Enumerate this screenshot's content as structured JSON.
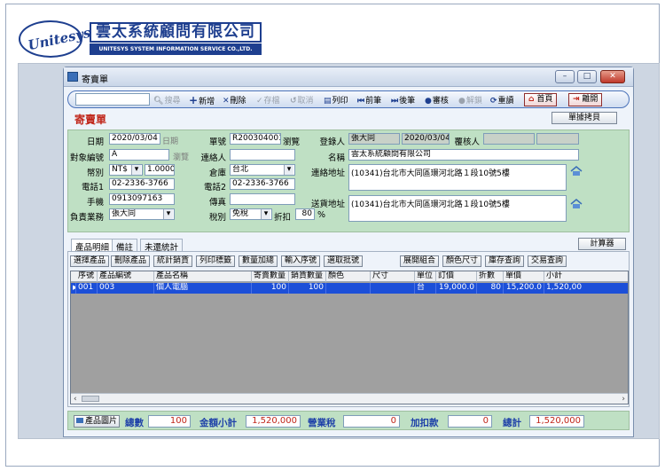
{
  "brand": {
    "logo_text": "Unitesys",
    "name_zh": "雲太系統顧問有限公司",
    "name_en": "UNITESYS SYSTEM INFORMATION SERVICE CO.,LTD."
  },
  "window": {
    "title": "寄賣單",
    "minimize": "–",
    "maximize": "□",
    "close": "✕"
  },
  "toolbar": {
    "search_value": "",
    "search": "搜尋",
    "add": "新增",
    "delete": "刪除",
    "save": "存檔",
    "cancel": "取消",
    "print": "列印",
    "prev": "前筆",
    "next": "後筆",
    "review": "審核",
    "unreview": "解鎖",
    "reload": "重讀",
    "home": "首頁",
    "exit": "離開"
  },
  "form": {
    "title": "寄賣單",
    "copy_button": "單據拷貝",
    "date_label": "日期",
    "date_value": "2020/03/04",
    "date_link": "日期",
    "order_no_label": "單號",
    "order_no_value": "R200304001",
    "browse": "瀏覽",
    "registrant_label": "登錄人",
    "registrant_value": "張大同",
    "registrant_date": "2020/03/04",
    "reviewer_label": "覆核人",
    "reviewer_value": "",
    "target_code_label": "對象編號",
    "target_code_value": "A",
    "browse2": "瀏覽",
    "contact_label": "連絡人",
    "contact_value": "",
    "name_label": "名稱",
    "name_value": "雲太系統顧問有限公司",
    "currency_label": "幣別",
    "currency_value": "NT$",
    "rate_value": "1.0000",
    "warehouse_label": "倉庫",
    "warehouse_value": "台北",
    "address_label": "連絡地址",
    "address_value": "(10341)台北市大同區環河北路１段10號5樓",
    "phone1_label": "電話1",
    "phone1_value": "02-2336-3766",
    "phone2_label": "電話2",
    "phone2_value": "02-2336-3766",
    "mobile_label": "手機",
    "mobile_value": "0913097163",
    "fax_label": "傳真",
    "fax_value": "",
    "ship_address_label": "送貨地址",
    "ship_address_value": "(10341)台北市大同區環河北路１段10號5樓",
    "sales_label": "負責業務",
    "sales_value": "張大同",
    "tax_label": "稅別",
    "tax_value": "免稅",
    "discount_label": "折扣",
    "discount_value": "80",
    "percent": "%"
  },
  "tabs": [
    "產品明細",
    "備註",
    "未還統計"
  ],
  "calculator": "計算器",
  "actions_left": [
    "選擇產品",
    "刪除產品",
    "統計銷貨",
    "列印標籤",
    "數量加總",
    "輸入序號",
    "選取批號"
  ],
  "actions_right": [
    "展開組合",
    "顏色尺寸",
    "庫存查詢",
    "交易查詢"
  ],
  "grid": {
    "columns": [
      "序號",
      "產品編號",
      "產品名稱",
      "寄賣數量",
      "銷貨數量",
      "顏色",
      "尺寸",
      "單位",
      "訂價",
      "折數",
      "單價",
      "小計"
    ],
    "rows": [
      [
        "001",
        "003",
        "個人電腦",
        "100",
        "100",
        "",
        "",
        "台",
        "19,000.0",
        "80",
        "15,200.0",
        "1,520,00"
      ]
    ]
  },
  "totals": {
    "image_button": "產品圖片",
    "qty_label": "總數",
    "qty_value": "100",
    "subtotal_label": "金額小計",
    "subtotal_value": "1,520,000",
    "tax_label": "營業稅",
    "tax_value": "0",
    "adjust_label": "加扣款",
    "adjust_value": "0",
    "total_label": "總計",
    "total_value": "1,520,000"
  }
}
